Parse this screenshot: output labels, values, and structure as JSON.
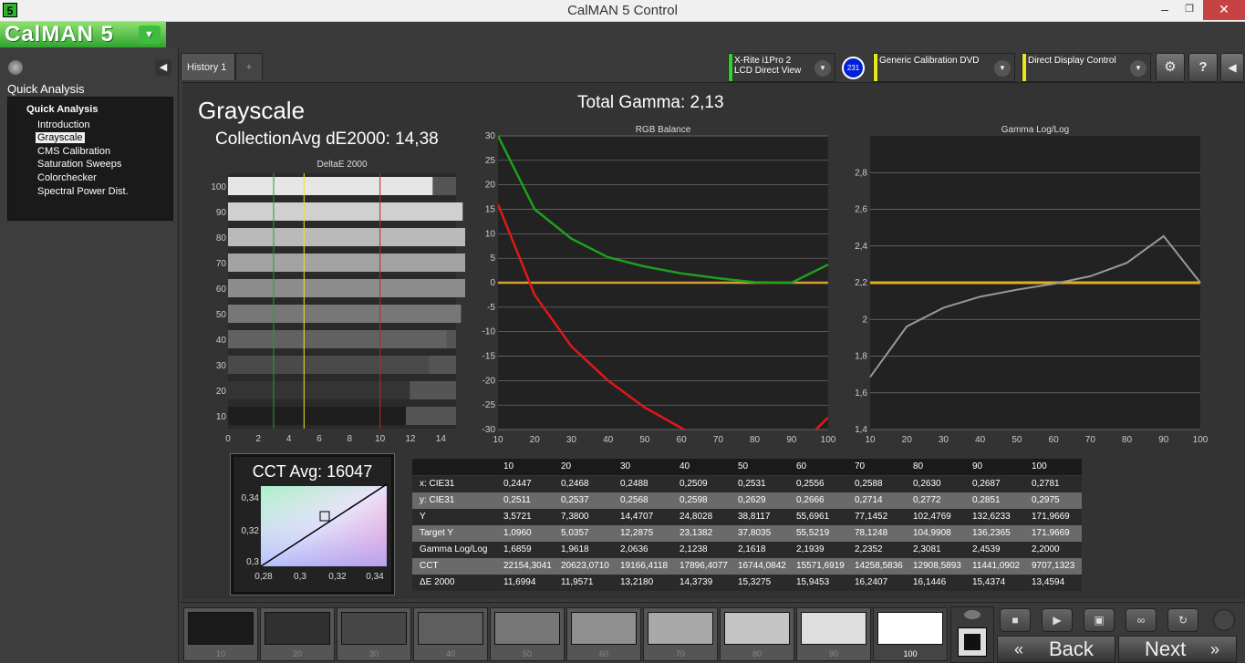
{
  "window": {
    "app_icon": "5",
    "title": "CalMAN 5 Control",
    "minimize": "–",
    "restore": "❐",
    "close": "✕"
  },
  "logo": {
    "text": "CalMAN 5",
    "dropdown": "▼"
  },
  "sidebar": {
    "collapse": "◀",
    "heading": "Quick Analysis",
    "root": "Quick Analysis",
    "items": [
      "Introduction",
      "Grayscale",
      "CMS Calibration",
      "Saturation Sweeps",
      "Colorchecker",
      "Spectral Power Dist."
    ]
  },
  "tabs": [
    {
      "label": "History 1"
    },
    {
      "label": "+"
    }
  ],
  "devices": [
    {
      "line1": "X-Rite i1Pro 2",
      "line2": "LCD Direct View",
      "color": "#2bd42b"
    },
    {
      "line1": "Generic Calibration DVD",
      "line2": "",
      "color": "#e8e81a"
    },
    {
      "line1": "Direct Display Control",
      "line2": "",
      "color": "#e8e81a"
    }
  ],
  "badge": "231",
  "toolbar": {
    "settings": "⚙",
    "help": "?",
    "expand": "◀",
    "dropdown": "▼"
  },
  "main": {
    "heading": "Grayscale",
    "collection": "CollectionAvg dE2000: 14,38",
    "total_gamma": "Total Gamma: 2,13"
  },
  "deltae_chart": {
    "title": "DeltaE 2000",
    "categories": [
      "10",
      "20",
      "30",
      "40",
      "50",
      "60",
      "70",
      "80",
      "90",
      "100"
    ],
    "values": [
      11.6994,
      11.9571,
      13.218,
      14.3739,
      15.3275,
      15.9453,
      16.2407,
      16.1446,
      15.4374,
      13.4594
    ],
    "x_ticks": [
      "0",
      "2",
      "4",
      "6",
      "8",
      "10",
      "12",
      "14"
    ],
    "xlim": [
      0,
      15
    ],
    "threshold_lines": [
      {
        "x": 3,
        "color": "#2d9a2d"
      },
      {
        "x": 5,
        "color": "#e8e81a"
      },
      {
        "x": 10,
        "color": "#d02020"
      }
    ]
  },
  "rgb_chart": {
    "title": "RGB Balance",
    "x": [
      10,
      20,
      30,
      40,
      50,
      60,
      70,
      80,
      90,
      100
    ],
    "red": [
      16,
      -2.5,
      -13,
      -20,
      -25.5,
      -29.7,
      -33.5,
      -36,
      -35,
      -27.5
    ],
    "green": [
      30,
      15,
      9,
      5.2,
      3.3,
      1.9,
      0.9,
      0.1,
      0,
      3.7
    ],
    "blue": [
      30.2,
      30.2,
      30.2,
      30.2,
      30.2,
      30.2,
      30.2,
      30.2,
      30.2,
      30.2
    ],
    "target": 0,
    "x_ticks": [
      "10",
      "20",
      "30",
      "40",
      "50",
      "60",
      "70",
      "80",
      "90",
      "100"
    ],
    "y_ticks": [
      "30",
      "25",
      "20",
      "15",
      "10",
      "5",
      "0",
      "-5",
      "-10",
      "-15",
      "-20",
      "-25",
      "-30"
    ],
    "ylim": [
      -30,
      30
    ]
  },
  "gamma_chart": {
    "title": "Gamma Log/Log",
    "x": [
      10,
      20,
      30,
      40,
      50,
      60,
      70,
      80,
      90,
      100
    ],
    "gamma": [
      1.6859,
      1.9618,
      2.0636,
      2.1238,
      2.1618,
      2.1939,
      2.2352,
      2.3081,
      2.4539,
      2.2
    ],
    "target": 2.2,
    "x_ticks": [
      "10",
      "20",
      "30",
      "40",
      "50",
      "60",
      "70",
      "80",
      "90",
      "100"
    ],
    "y_ticks": [
      "2,8",
      "2,6",
      "2,4",
      "2,2",
      "2",
      "1,8",
      "1,6",
      "1,4"
    ],
    "ylim": [
      1.4,
      3.0
    ]
  },
  "cct": {
    "title": "CCT Avg: 16047",
    "x_ticks": [
      "0,28",
      "0,3",
      "0,32",
      "0,34"
    ],
    "y_ticks": [
      "0,34",
      "0,32",
      "0,3"
    ]
  },
  "table": {
    "columns": [
      "",
      "10",
      "20",
      "30",
      "40",
      "50",
      "60",
      "70",
      "80",
      "90",
      "100"
    ],
    "rows": [
      [
        "x: CIE31",
        "0,2447",
        "0,2468",
        "0,2488",
        "0,2509",
        "0,2531",
        "0,2556",
        "0,2588",
        "0,2630",
        "0,2687",
        "0,2781"
      ],
      [
        "y: CIE31",
        "0,2511",
        "0,2537",
        "0,2568",
        "0,2598",
        "0,2629",
        "0,2666",
        "0,2714",
        "0,2772",
        "0,2851",
        "0,2975"
      ],
      [
        "Y",
        "3,5721",
        "7,3800",
        "14,4707",
        "24,8028",
        "38,8117",
        "55,6961",
        "77,1452",
        "102,4769",
        "132,6233",
        "171,9669"
      ],
      [
        "Target Y",
        "1,0960",
        "5,0357",
        "12,2875",
        "23,1382",
        "37,8035",
        "55,5219",
        "78,1248",
        "104,9908",
        "136,2365",
        "171,9669"
      ],
      [
        "Gamma Log/Log",
        "1,6859",
        "1,9618",
        "2,0636",
        "2,1238",
        "2,1618",
        "2,1939",
        "2,2352",
        "2,3081",
        "2,4539",
        "2,2000"
      ],
      [
        "CCT",
        "22154,3041",
        "20623,0710",
        "19166,4118",
        "17896,4077",
        "16744,0842",
        "15571,6919",
        "14258,5836",
        "12908,5893",
        "11441,0902",
        "9707,1323"
      ],
      [
        "ΔE 2000",
        "11,6994",
        "11,9571",
        "13,2180",
        "14,3739",
        "15,3275",
        "15,9453",
        "16,2407",
        "16,1446",
        "15,4374",
        "13,4594"
      ]
    ]
  },
  "swatches": [
    {
      "label": "10",
      "color": "#1a1a1a"
    },
    {
      "label": "20",
      "color": "#303030"
    },
    {
      "label": "30",
      "color": "#474747"
    },
    {
      "label": "40",
      "color": "#5e5e5e"
    },
    {
      "label": "50",
      "color": "#777777"
    },
    {
      "label": "60",
      "color": "#8f8f8f"
    },
    {
      "label": "70",
      "color": "#a9a9a9"
    },
    {
      "label": "80",
      "color": "#c4c4c4"
    },
    {
      "label": "90",
      "color": "#dedede"
    },
    {
      "label": "100",
      "color": "#ffffff",
      "selected": true
    }
  ],
  "controls": {
    "stop": "■",
    "play": "▶",
    "save": "▣",
    "loop": "∞",
    "refresh": "↻",
    "back": "Back",
    "next": "Next",
    "back_arrow": "«",
    "next_arrow": "»"
  }
}
